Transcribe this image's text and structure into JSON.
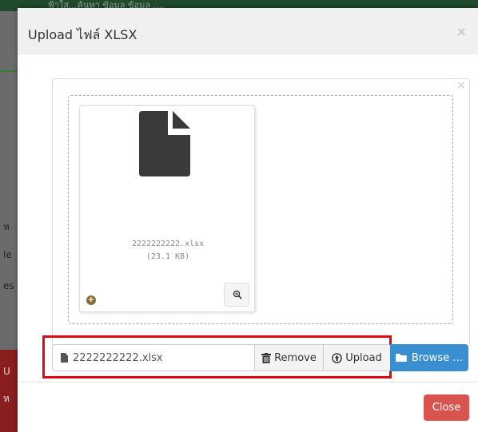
{
  "background": {
    "top_bar_text": "ฟ้าใส...ค้นหา ข้อมูล ข้อมูล ....",
    "side_texts": [
      "ห",
      "le",
      "es",
      "U",
      "ห"
    ]
  },
  "modal": {
    "title": "Upload ไฟล์ XLSX",
    "close_symbol": "×",
    "preview_close_symbol": "×",
    "file": {
      "name": "2222222222.xlsx",
      "size": "(23.1 KB)"
    },
    "input": {
      "filename": "2222222222.xlsx",
      "remove_label": "Remove",
      "upload_label": "Upload",
      "browse_label": "Browse …"
    },
    "footer": {
      "close_label": "Close"
    }
  },
  "icons": {
    "document": "document-icon",
    "plus": "plus-circle-icon",
    "zoom": "zoom-in-icon",
    "trash": "trash-icon",
    "upload": "upload-circle-icon",
    "folder": "folder-open-icon",
    "file_small": "file-icon"
  },
  "colors": {
    "highlight": "#e30613",
    "browse": "#3a8fd1",
    "close": "#d9534f",
    "doc_icon": "#3a3a3a"
  }
}
